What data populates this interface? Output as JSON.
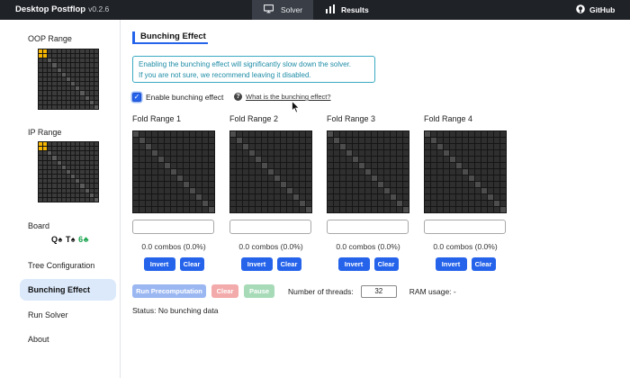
{
  "header": {
    "app_title": "Desktop Postflop",
    "version": "v0.2.6",
    "nav": {
      "solver": "Solver",
      "results": "Results",
      "github": "GitHub"
    }
  },
  "sidebar": {
    "oop_range_label": "OOP Range",
    "ip_range_label": "IP Range",
    "board_label": "Board",
    "board_cards": [
      {
        "text": "Q♠",
        "color": "#111111"
      },
      {
        "text": "T♠",
        "color": "#111111"
      },
      {
        "text": "6♣",
        "color": "#16a34a"
      }
    ],
    "items": [
      {
        "label": "Tree Configuration",
        "active": false
      },
      {
        "label": "Bunching Effect",
        "active": true
      },
      {
        "label": "Run Solver",
        "active": false
      },
      {
        "label": "About",
        "active": false
      }
    ]
  },
  "main": {
    "title": "Bunching Effect",
    "warning_line1": "Enabling the bunching effect will significantly slow down the solver.",
    "warning_line2": "If you are not sure, we recommend leaving it disabled.",
    "enable_label": "Enable bunching effect",
    "enable_checked": true,
    "help_link": "What is the bunching effect?",
    "folds": [
      {
        "title": "Fold Range 1",
        "value": "",
        "combos": "0.0 combos (0.0%)",
        "invert": "Invert",
        "clear": "Clear"
      },
      {
        "title": "Fold Range 2",
        "value": "",
        "combos": "0.0 combos (0.0%)",
        "invert": "Invert",
        "clear": "Clear"
      },
      {
        "title": "Fold Range 3",
        "value": "",
        "combos": "0.0 combos (0.0%)",
        "invert": "Invert",
        "clear": "Clear"
      },
      {
        "title": "Fold Range 4",
        "value": "",
        "combos": "0.0 combos (0.0%)",
        "invert": "Invert",
        "clear": "Clear"
      }
    ],
    "run_button": "Run Precomputation",
    "clear_button": "Clear",
    "pause_button": "Pause",
    "threads_label": "Number of threads:",
    "threads_value": "32",
    "ram_label": "RAM usage: -",
    "status": "Status: No bunching data"
  },
  "colors": {
    "accent": "#2563eb",
    "topbar": "#1f2227",
    "warning": "#1e8ca6",
    "selected_cell": "#f4b400",
    "active_nav_bg": "#dbe9fb"
  },
  "icons": {
    "solver": "monitor-icon",
    "results": "bar-chart-icon",
    "github": "github-icon",
    "help": "question-circle-icon",
    "cursor": "mouse-pointer-icon"
  }
}
